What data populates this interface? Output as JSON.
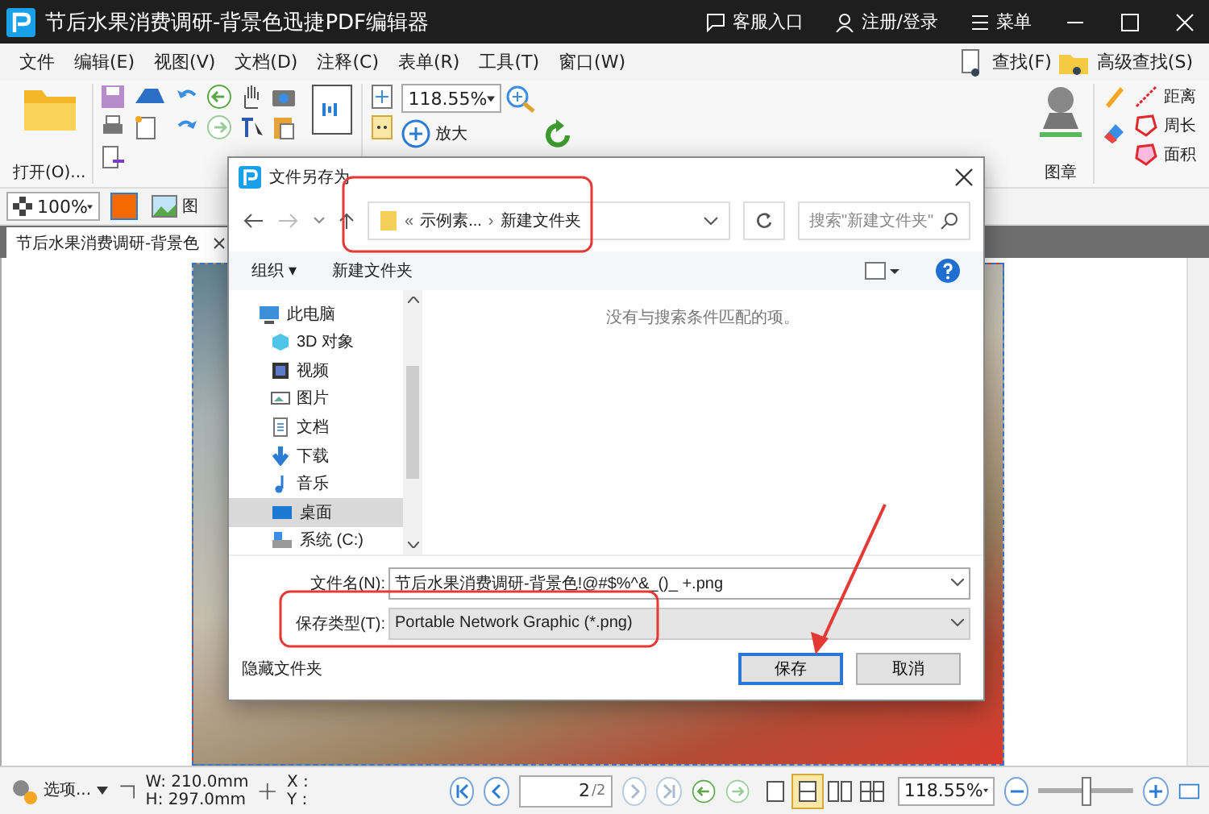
{
  "window": {
    "title": "节后水果消费调研-背景色迅捷PDF编辑器",
    "links": [
      {
        "kind": "support",
        "label": "客服入口"
      },
      {
        "kind": "user",
        "label": "注册/登录"
      },
      {
        "kind": "menu",
        "label": "菜单"
      }
    ]
  },
  "menu": [
    "文件",
    "编辑(E)",
    "视图(V)",
    "文档(D)",
    "注释(C)",
    "表单(R)",
    "工具(T)",
    "窗口(W)"
  ],
  "search_links": [
    {
      "kind": "find",
      "label": "查找(F)"
    },
    {
      "kind": "advanced",
      "label": "高级查找(S)"
    }
  ],
  "ribbon": {
    "open": "打开(O)...",
    "zoom": "118.55%",
    "zoom_in": "放大",
    "stamp": "图章",
    "measure": [
      {
        "kind": "distance",
        "label": "距离"
      },
      {
        "kind": "perimeter",
        "label": "周长"
      },
      {
        "kind": "area",
        "label": "面积"
      }
    ]
  },
  "format_bar": {
    "opacity": "100%",
    "image": "图"
  },
  "doc_tab": {
    "title": "节后水果消费调研-背景色"
  },
  "dialog": {
    "title": "文件另存为",
    "breadcrumb": [
      "«",
      "示例素...",
      "›",
      "新建文件夹"
    ],
    "search": {
      "placeholder": "搜索\"新建文件夹\""
    },
    "toolbar": [
      "组织 ▾",
      "新建文件夹"
    ],
    "nav": [
      {
        "kind": "pc",
        "label": "此电脑",
        "selected": false,
        "children": [
          {
            "kind": "cube",
            "label": "3D 对象",
            "selected": false
          },
          {
            "kind": "film",
            "label": "视频",
            "selected": false
          },
          {
            "kind": "picture",
            "label": "图片",
            "selected": false
          },
          {
            "kind": "doc",
            "label": "文档",
            "selected": false
          },
          {
            "kind": "download",
            "label": "下载",
            "selected": false
          },
          {
            "kind": "music",
            "label": "音乐",
            "selected": false
          },
          {
            "kind": "desktop",
            "label": "桌面",
            "selected": true
          },
          {
            "kind": "drive",
            "label": "系统 (C:)",
            "selected": false
          }
        ]
      }
    ],
    "empty_message": "没有与搜索条件匹配的项。",
    "filename": {
      "label": "文件名(N):",
      "value": "节后水果消费调研-背景色!@#$%^&_()_ +.png"
    },
    "filetype": {
      "label": "保存类型(T):",
      "value": "Portable Network Graphic (*.png)"
    },
    "hide_folders": "隐藏文件夹",
    "buttons": [
      {
        "label": "保存",
        "default": true
      },
      {
        "label": "取消",
        "default": false
      }
    ]
  },
  "status_bar": {
    "options": "选项...",
    "width": "W: 210.0mm",
    "height": "H: 297.0mm",
    "x": "X :",
    "y": "Y :",
    "page": "2",
    "page_total": "/2",
    "zoom": "118.55%",
    "zoom_slider": {
      "level": 0.5
    },
    "page_layouts": [
      {
        "kind": "single",
        "selected": false
      },
      {
        "kind": "continuous",
        "selected": true
      },
      {
        "kind": "facing",
        "selected": false
      },
      {
        "kind": "continuous-facing",
        "selected": false
      }
    ]
  }
}
